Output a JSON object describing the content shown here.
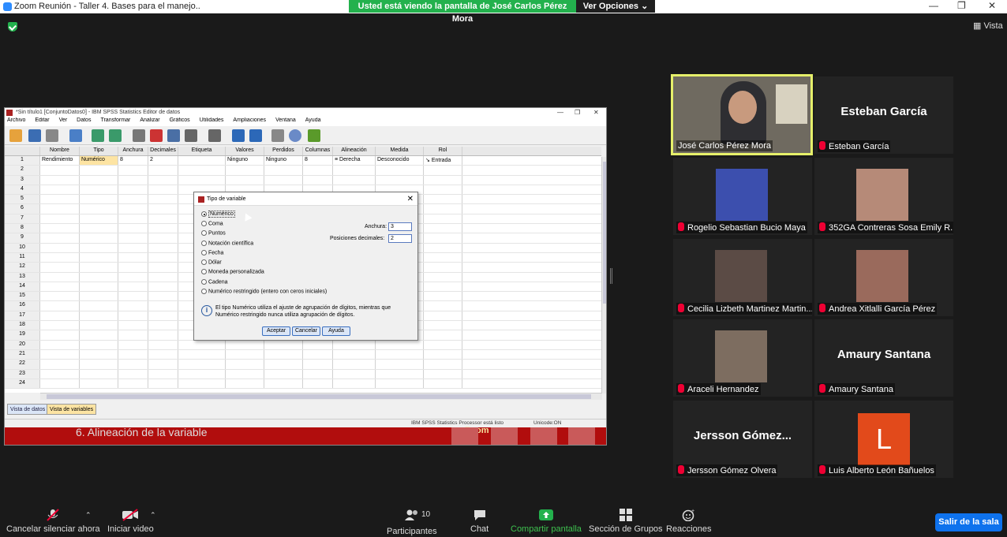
{
  "window": {
    "title": "Zoom Reunión - Taller 4. Bases para el manejo..",
    "controls": [
      "—",
      "❐",
      "✕"
    ]
  },
  "share_banner": {
    "text": "Usted está viendo la pantalla de José Carlos Pérez Mora",
    "options_label": "Ver Opciones ⌄"
  },
  "view_label": "Vista",
  "spss": {
    "title": "*Sin título1 [ConjuntoDatos0] - IBM SPSS Statistics Editor de datos",
    "window_controls": [
      "—",
      "❐",
      "✕"
    ],
    "menu": [
      "Archivo",
      "Editar",
      "Ver",
      "Datos",
      "Transformar",
      "Analizar",
      "Gráficos",
      "Utilidades",
      "Ampliaciones",
      "Ventana",
      "Ayuda"
    ],
    "columns": [
      "Nombre",
      "Tipo",
      "Anchura",
      "Decimales",
      "Etiqueta",
      "Valores",
      "Perdidos",
      "Columnas",
      "Alineación",
      "Medida",
      "Rol"
    ],
    "row1": [
      "Rendimiento",
      "Numérico",
      "8",
      "2",
      "",
      "Ninguno",
      "Ninguno",
      "8",
      "Derecha",
      "Desconocido",
      "Entrada"
    ],
    "row_numbers": [
      "1",
      "2",
      "3",
      "4",
      "5",
      "6",
      "7",
      "8",
      "9",
      "10",
      "11",
      "12",
      "13",
      "14",
      "15",
      "16",
      "17",
      "18",
      "19",
      "20",
      "21",
      "22",
      "23",
      "24"
    ],
    "tabs": {
      "data": "Vista de datos",
      "variables": "Vista de variables"
    },
    "status": {
      "processor": "IBM SPSS Statistics Processor está listo",
      "unicode": "Unicode:ON"
    },
    "underlying_slide_text": "6.   Alineación de la variable",
    "underlying_slide_fragment": "Reom"
  },
  "dialog": {
    "title": "Tipo de variable",
    "options": [
      "Numérico",
      "Coma",
      "Puntos",
      "Notación científica",
      "Fecha",
      "Dólar",
      "Moneda personalizada",
      "Cadena",
      "Numérico restringido (entero con ceros iniciales)"
    ],
    "width_label": "Anchura:",
    "width_value": "3",
    "decimals_label": "Posiciones decimales:",
    "decimals_value": "2",
    "info": "El tipo Numérico utiliza el ajuste de agrupación de dígitos, mientras que Numérico restringido nunca utiliza agrupación de dígitos.",
    "buttons": {
      "ok": "Aceptar",
      "cancel": "Cancelar",
      "help": "Ayuda"
    }
  },
  "participants": [
    {
      "name": "José Carlos Pérez Mora",
      "muted": false,
      "active": true,
      "display": "video"
    },
    {
      "name": "Esteban García",
      "muted": true,
      "display": "name",
      "big_name": "Esteban García"
    },
    {
      "name": "Rogelio Sebastian Bucio Maya",
      "muted": true,
      "display": "photo"
    },
    {
      "name": "352GA  Contreras Sosa Emily R...",
      "muted": true,
      "display": "photo"
    },
    {
      "name": "Cecilia Lizbeth Martinez Martin...",
      "muted": true,
      "display": "photo"
    },
    {
      "name": "Andrea Xitlalli García Pérez",
      "muted": true,
      "display": "photo"
    },
    {
      "name": "Araceli Hernandez",
      "muted": true,
      "display": "photo"
    },
    {
      "name": "Amaury Santana",
      "muted": true,
      "display": "name",
      "big_name": "Amaury Santana"
    },
    {
      "name": "Jersson Gómez Olvera",
      "muted": true,
      "display": "name",
      "big_name": "Jersson  Gómez..."
    },
    {
      "name": "Luis Alberto León Bañuelos",
      "muted": true,
      "display": "avatar",
      "initial": "L"
    }
  ],
  "controls": {
    "unmute": "Cancelar silenciar ahora",
    "start_video": "Iniciar video",
    "participants": "Participantes",
    "participants_count": "10",
    "chat": "Chat",
    "share": "Compartir pantalla",
    "breakout": "Sección de Grupos",
    "reactions": "Reacciones",
    "leave": "Salir de la sala"
  }
}
